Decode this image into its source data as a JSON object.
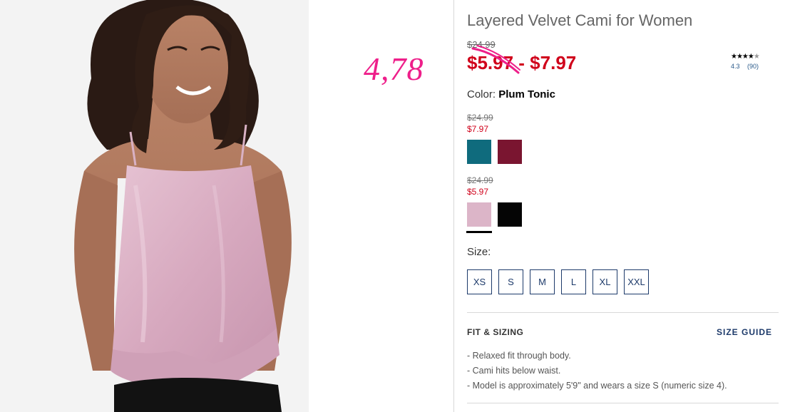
{
  "product": {
    "title": "Layered Velvet Cami for Women",
    "original_price": "$24.99",
    "price_range": "$5.97 - $7.97",
    "rating": {
      "stars": "★★★★",
      "half_star": "★",
      "value": "4.3",
      "count": "(90)"
    },
    "color_label": "Color:",
    "color_name": "Plum Tonic",
    "swatch_groups": [
      {
        "original": "$24.99",
        "sale": "$7.97",
        "swatches": [
          {
            "name": "teal",
            "color": "#0f6b7d"
          },
          {
            "name": "burgundy",
            "color": "#7a1530"
          }
        ]
      },
      {
        "original": "$24.99",
        "sale": "$5.97",
        "swatches": [
          {
            "name": "plum-tonic",
            "color": "#dcb5c8"
          },
          {
            "name": "black",
            "color": "#050505"
          }
        ]
      }
    ],
    "size_label": "Size:",
    "sizes": [
      "XS",
      "S",
      "M",
      "L",
      "XL",
      "XXL"
    ],
    "fit_title": "FIT & SIZING",
    "size_guide": "SIZE GUIDE",
    "fit_bullets": [
      "Relaxed fit through body.",
      "Cami hits below waist.",
      "Model is approximately 5'9\" and wears a size S (numeric size 4)."
    ]
  },
  "annotation": {
    "text": "4,78",
    "color": "#ee1f8a"
  },
  "colors": {
    "sale_red": "#d0021b",
    "navy": "#1d3a6a"
  },
  "icons": {
    "strike_mark": "pink-scribble-strikethrough"
  }
}
